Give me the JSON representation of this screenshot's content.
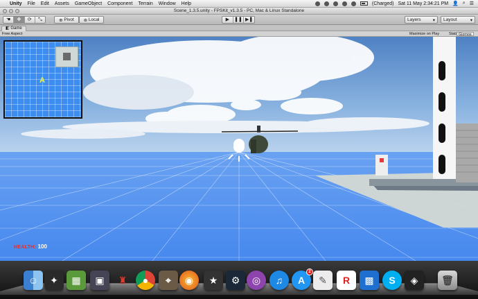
{
  "menubar": {
    "app_name": "Unity",
    "items": [
      "File",
      "Edit",
      "Assets",
      "GameObject",
      "Component",
      "Terrain",
      "Window",
      "Help"
    ],
    "battery_status": "(Charged)",
    "clock": "Sat 11 May  2:34:21 PM"
  },
  "window": {
    "title": "Scene_1.3.5.unity - FPSKit_v1.3.5 - PC, Mac & Linux Standalone"
  },
  "toolbar": {
    "tools": [
      "☚",
      "✥",
      "⟳",
      "⤡"
    ],
    "pivot_label": "Pivot",
    "local_label": "Local",
    "play_icon": "▶",
    "pause_icon": "❚❚",
    "step_icon": "▶❚",
    "layers_label": "Layers",
    "layout_label": "Layout"
  },
  "game_panel": {
    "tab_label": "Game",
    "aspect_label": "Free Aspect",
    "maximize_label": "Maximize on Play",
    "stats_label": "Stats",
    "gizmos_label": "Gizmos"
  },
  "hud": {
    "health_label": "HEALTH:",
    "health_value": "100",
    "minimap_marker": "A"
  },
  "dock": {
    "icons": [
      "finder-icon",
      "game-icon",
      "minecraft-icon",
      "app-icon",
      "mario-icon",
      "chrome-icon",
      "iphoto-icon",
      "firefox-icon",
      "imovie-icon",
      "steam-icon",
      "podcast-icon",
      "itunes-icon",
      "app-store-icon",
      "preview-icon",
      "roblox-icon",
      "lego-icon",
      "skype-icon",
      "unity-icon",
      "trash-icon"
    ],
    "app_store_badge": "2"
  },
  "colors": {
    "sky": "#6f9fd6",
    "ground": "#4f8ef0",
    "minimap": "#3d8df0",
    "health_label": "#e03030"
  }
}
